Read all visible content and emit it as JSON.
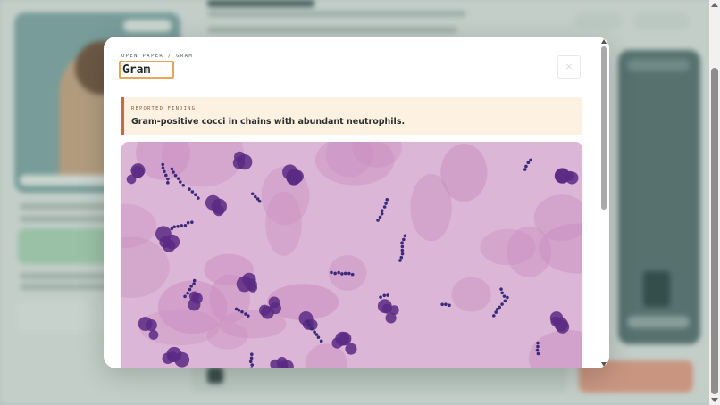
{
  "modal": {
    "eyebrow": "OPEN PAPER / GRAM",
    "title": "Gram",
    "close_label": "×",
    "finding": {
      "label": "REPORTED FINDING",
      "text": "Gram-positive cocci in chains with abundant neutrophils."
    },
    "image_subject": "gram-stain-micrograph",
    "image_colors": {
      "background": "#dcb6d6",
      "cell_pink": "#c98dc0",
      "nucleus": "#5a2a84",
      "cocci": "#3b2a7a"
    }
  },
  "colors": {
    "accent": "#e8a55c",
    "finding_border": "#d1683a",
    "finding_bg": "#fdf1e2"
  }
}
